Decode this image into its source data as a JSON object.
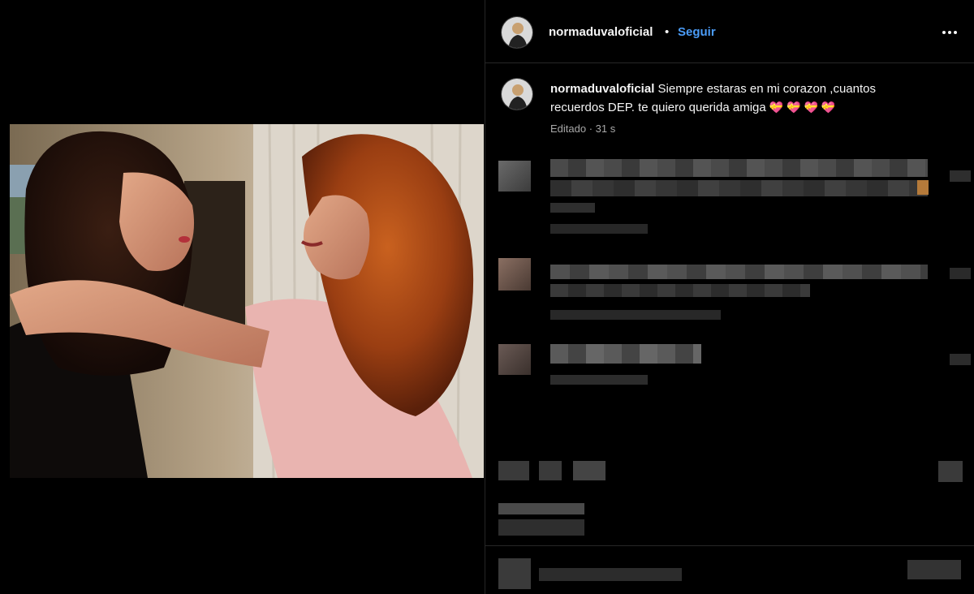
{
  "post": {
    "username": "normaduvaloficial",
    "separator": "•",
    "follow_label": "Seguir",
    "more_icon": "more-horizontal-icon",
    "caption_user": "normaduvaloficial",
    "caption_text_line1": " Siempre estaras en mi corazon ,cuantos",
    "caption_text_line2": "recuerdos DEP. te quiero querida amiga ",
    "caption_emoji": "💝 💝 💝 💝",
    "meta": "Editado · 31 s"
  },
  "colors": {
    "follow": "#4b9cf7",
    "background": "#000000",
    "divider": "#262626",
    "muted": "#a8a8a8"
  }
}
